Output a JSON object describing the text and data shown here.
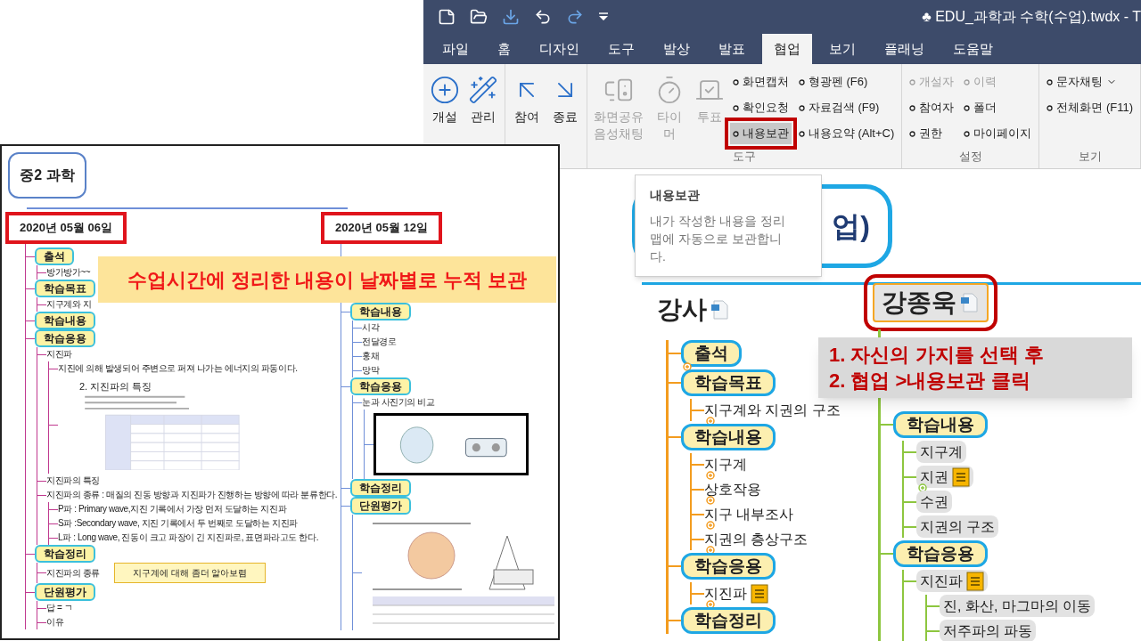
{
  "app": {
    "title_mark": "♣",
    "title": "EDU_과학과 수학(수업).twdx - T",
    "tabs": [
      {
        "label": "파일",
        "selected": false
      },
      {
        "label": "홈",
        "selected": false
      },
      {
        "label": "디자인",
        "selected": false
      },
      {
        "label": "도구",
        "selected": false
      },
      {
        "label": "발상",
        "selected": false
      },
      {
        "label": "발표",
        "selected": false
      },
      {
        "label": "협업",
        "selected": true
      },
      {
        "label": "보기",
        "selected": false
      },
      {
        "label": "플래닝",
        "selected": false
      },
      {
        "label": "도움말",
        "selected": false
      }
    ],
    "ribbon": [
      {
        "large": [
          {
            "label": "개설",
            "disabled": false
          },
          {
            "label": "관리",
            "disabled": false
          }
        ]
      },
      {
        "large": [
          {
            "label": "참여",
            "disabled": false
          },
          {
            "label": "종료",
            "disabled": false
          }
        ]
      },
      {
        "label": "도구",
        "large": [
          {
            "label": "화면공유 음성채팅",
            "disabled": true
          },
          {
            "label": "타이머",
            "disabled": true
          },
          {
            "label": "투표",
            "disabled": true
          }
        ],
        "small_columns": [
          [
            {
              "label": "화면캡처",
              "disabled": false,
              "selected": false
            },
            {
              "label": "확인요청",
              "disabled": false,
              "selected": false
            },
            {
              "label": "내용보관",
              "disabled": false,
              "selected": true
            }
          ],
          [
            {
              "label": "형광펜 (F6)",
              "disabled": false,
              "selected": false
            },
            {
              "label": "자료검색 (F9)",
              "disabled": false,
              "selected": false
            },
            {
              "label": "내용요약 (Alt+C)",
              "disabled": false,
              "selected": false
            }
          ]
        ]
      },
      {
        "label": "설정",
        "small_columns": [
          [
            {
              "label": "개설자",
              "disabled": true,
              "selected": false
            },
            {
              "label": "참여자",
              "disabled": false,
              "selected": false
            },
            {
              "label": "권한",
              "disabled": false,
              "selected": false
            }
          ],
          [
            {
              "label": "이력",
              "disabled": true,
              "selected": false
            },
            {
              "label": "폴더",
              "disabled": false,
              "selected": false
            },
            {
              "label": "마이페이지",
              "disabled": false,
              "selected": false
            }
          ]
        ]
      },
      {
        "label": "보기",
        "small_columns": [
          [
            {
              "label": "문자채팅",
              "disabled": false,
              "selected": false,
              "dropdown": true
            },
            {
              "label": "전체화면 (F11)",
              "disabled": false,
              "selected": false
            }
          ]
        ]
      }
    ]
  },
  "tooltip": {
    "title": "내용보관",
    "text": "내가 작성한 내용을 정리 맵에 자동으로 보관합니다."
  },
  "canvas": {
    "central_topic": "업)",
    "branches": [
      {
        "label": "강사",
        "selected": false,
        "kind": "plain",
        "color": "#f39c1f",
        "children": [
          {
            "kind": "topic",
            "label": "출석",
            "collapsed": true
          },
          {
            "kind": "topic",
            "label": "학습목표",
            "collapsed": false,
            "children": [
              {
                "kind": "leaf",
                "label": "지구계와 지권의 구조",
                "collapsed": true
              }
            ]
          },
          {
            "kind": "topic",
            "label": "학습내용",
            "collapsed": false,
            "children": [
              {
                "kind": "leaf",
                "label": "지구계",
                "collapsed": true
              },
              {
                "kind": "leaf",
                "label": "상호작용",
                "collapsed": true
              },
              {
                "kind": "leaf",
                "label": "지구 내부조사",
                "collapsed": true
              },
              {
                "kind": "leaf",
                "label": "지권의 층상구조",
                "collapsed": true
              }
            ]
          },
          {
            "kind": "topic",
            "label": "학습응용",
            "collapsed": false,
            "children": [
              {
                "kind": "leaf",
                "label": "지진파",
                "collapsed": true,
                "note": true
              }
            ]
          },
          {
            "kind": "topic",
            "label": "학습정리",
            "collapsed": false
          }
        ]
      },
      {
        "label": "강종욱",
        "selected": true,
        "kind": "shaded",
        "color": "#8dc63f",
        "children": [
          {
            "kind": "topic",
            "label": "학습내용",
            "collapsed": false,
            "children": [
              {
                "kind": "leaf",
                "label": "지구계",
                "collapsed": false
              },
              {
                "kind": "leaf",
                "label": "지권",
                "collapsed": true,
                "note": true
              },
              {
                "kind": "leaf",
                "label": "수권",
                "collapsed": false
              },
              {
                "kind": "leaf",
                "label": "지권의 구조",
                "collapsed": false
              }
            ]
          },
          {
            "kind": "topic",
            "label": "학습응용",
            "collapsed": false,
            "children": [
              {
                "kind": "leaf",
                "label": "지진파",
                "collapsed": false,
                "note": true,
                "children": [
                  {
                    "kind": "leaf",
                    "label": "진, 화산, 마그마의 이동",
                    "collapsed": false
                  },
                  {
                    "kind": "leaf",
                    "label": "저주파의 파동",
                    "collapsed": false
                  }
                ]
              }
            ]
          }
        ]
      }
    ]
  },
  "instructions": [
    "1. 자신의 가지를 선택 후",
    "2. 협업 >내용보관 클릭"
  ],
  "document": {
    "central_topic": "중2 과학",
    "banner": "수업시간에 정리한 내용이 날짜별로 누적 보관",
    "columns": [
      {
        "date": "2020년 05월 06일",
        "color": "#c0398f",
        "children": [
          {
            "kind": "topic",
            "label": "출석",
            "children": [
              {
                "kind": "text",
                "label": "방가방가~~"
              }
            ]
          },
          {
            "kind": "topic",
            "label": "학습목표",
            "children": [
              {
                "kind": "text",
                "label": "지구계와 지"
              }
            ]
          },
          {
            "kind": "topic",
            "label": "학습내용"
          },
          {
            "kind": "topic",
            "label": "학습응용",
            "children": [
              {
                "kind": "text",
                "label": "지진파",
                "children": [
                  {
                    "kind": "text",
                    "label": "지진에 의해 발생되어 주변으로 퍼져 나가는 에너지의 파동이다."
                  },
                  {
                    "kind": "figure",
                    "label": "2. 지진파의 특징"
                  }
                ]
              },
              {
                "kind": "text",
                "label": "지진파의 특징"
              },
              {
                "kind": "text",
                "label": "지진파의 종류 : 매질의 진동 방향과 지진파가 진행하는 방향에 따라 분류한다.",
                "children": [
                  {
                    "kind": "text",
                    "label": "P파 : Primary wave,지진 기록에서 가장 먼저 도달하는 지진파"
                  },
                  {
                    "kind": "text",
                    "label": "S파 :Secondary wave, 지진 기록에서 두 번째로 도달하는 지진파"
                  },
                  {
                    "kind": "text",
                    "label": "L파 : Long wave, 진동이 크고 파장이 긴 지진파로, 표면파라고도 한다."
                  }
                ]
              }
            ]
          },
          {
            "kind": "topic",
            "label": "학습정리",
            "children": [
              {
                "kind": "text",
                "label": "지진파의 종류",
                "note": "지구계에 대해 좀더 알아보렴"
              }
            ]
          },
          {
            "kind": "topic",
            "label": "단원평가",
            "children": [
              {
                "kind": "text",
                "label": "답 = ㄱ"
              },
              {
                "kind": "text",
                "label": "이유"
              }
            ]
          }
        ]
      },
      {
        "date": "2020년 05월 12일",
        "color": "#6f8fd8",
        "children": [
          {
            "kind": "topic",
            "label": "학습내용",
            "children": [
              {
                "kind": "text",
                "label": "시각"
              },
              {
                "kind": "text",
                "label": "전달경로"
              },
              {
                "kind": "text",
                "label": "홍채"
              },
              {
                "kind": "text",
                "label": "망막"
              }
            ]
          },
          {
            "kind": "topic",
            "label": "학습응용",
            "children": [
              {
                "kind": "text",
                "label": "눈과 사진기의 비교",
                "children": [
                  {
                    "kind": "picture"
                  }
                ]
              }
            ]
          },
          {
            "kind": "topic",
            "label": "학습정리"
          },
          {
            "kind": "topic",
            "label": "단원평가",
            "children": [
              {
                "kind": "worksheet"
              }
            ]
          }
        ]
      }
    ]
  }
}
